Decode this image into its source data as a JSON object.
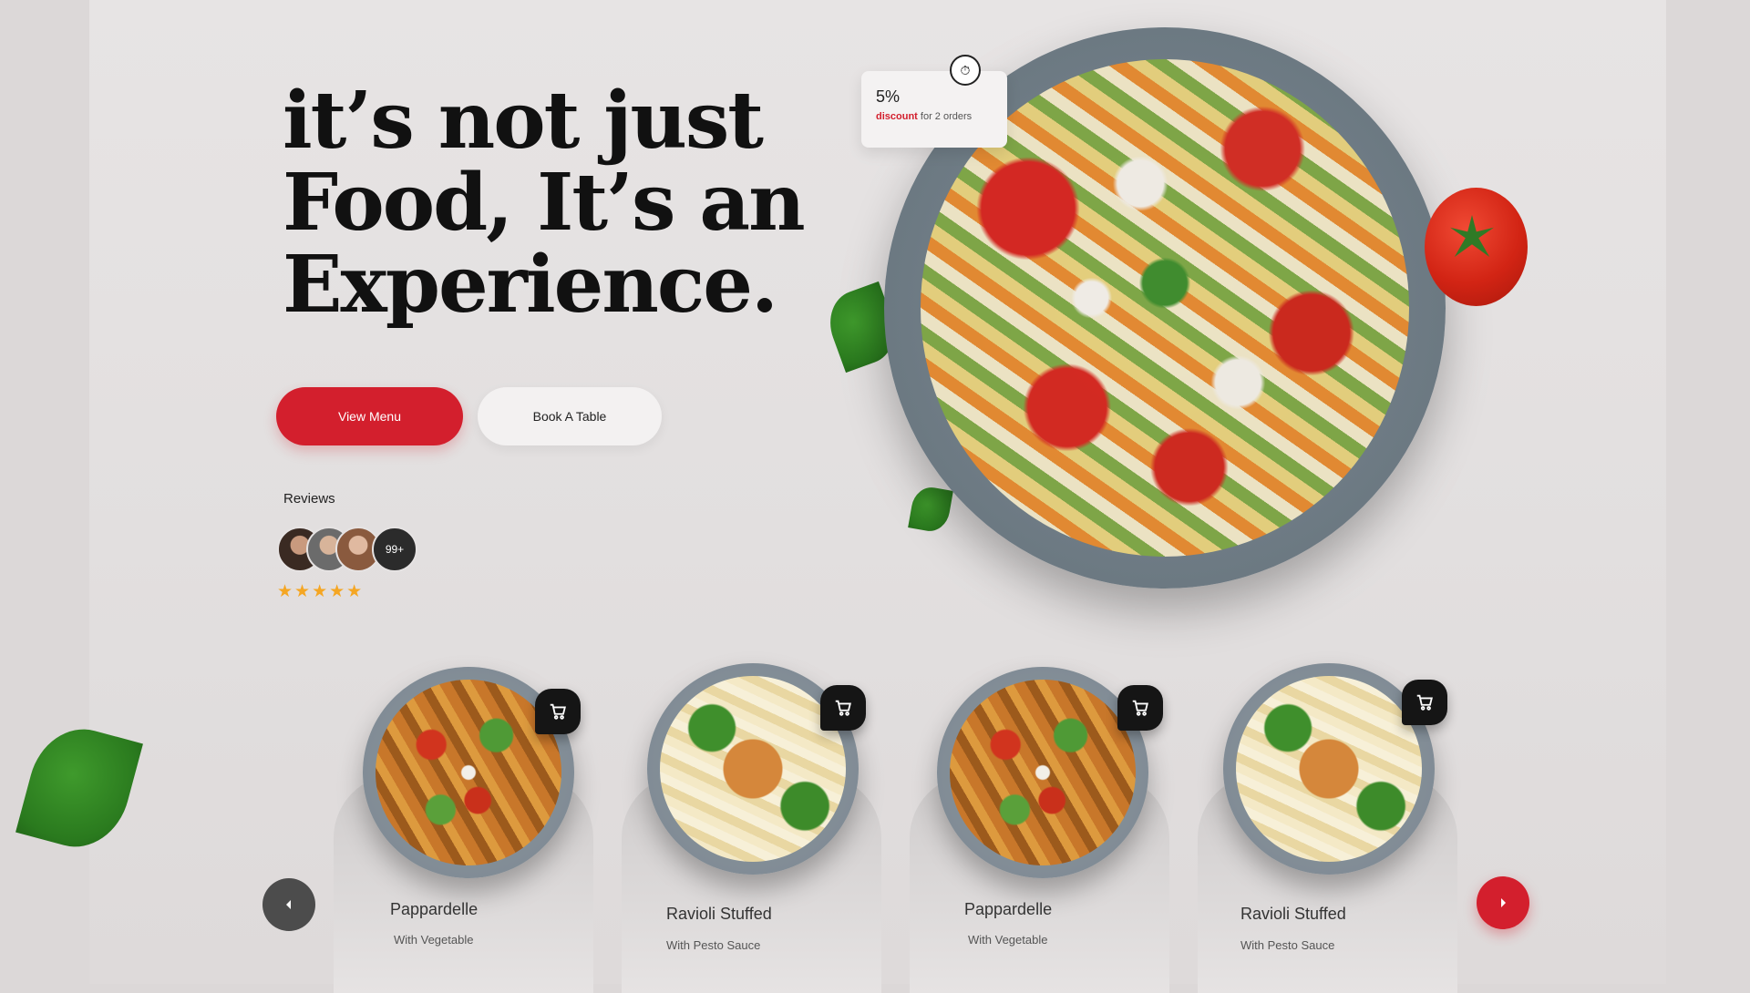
{
  "hero": {
    "headline": [
      "it’s not just",
      "Food, It’s an",
      "Experience."
    ],
    "primary_button": "View Menu",
    "secondary_button": "Book A Table",
    "reviews_label": "Reviews",
    "reviews_more": "99+",
    "rating_stars": "★★★★★",
    "rating": 5
  },
  "discount": {
    "value": "5%",
    "highlight": "discount",
    "text": "for 2 orders"
  },
  "menu": {
    "items": [
      {
        "title": "Pappardelle",
        "subtitle": "With Vegetable",
        "image": "salad-bowl"
      },
      {
        "title": "Ravioli Stuffed",
        "subtitle": "With Pesto Sauce",
        "image": "ravioli-bowl"
      },
      {
        "title": "Pappardelle",
        "subtitle": "With Vegetable",
        "image": "salad-bowl"
      },
      {
        "title": "Ravioli Stuffed",
        "subtitle": "With Pesto Sauce",
        "image": "ravioli-bowl"
      }
    ]
  },
  "colors": {
    "accent": "#d31f2d",
    "star": "#f5a623",
    "dark": "#151515"
  }
}
